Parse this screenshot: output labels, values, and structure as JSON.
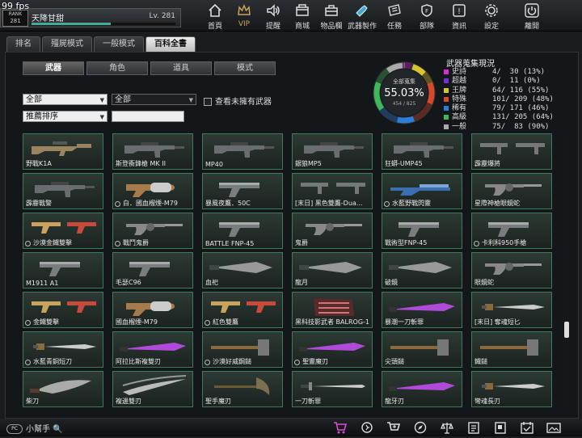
{
  "fps": "99 fps",
  "player": {
    "rank": "281",
    "name": "天降甘甜",
    "level": "Lv. 281",
    "xp_fraction": 0.55
  },
  "nav": [
    {
      "label": "首頁",
      "icon": "home-icon"
    },
    {
      "label": "VIP",
      "icon": "crown-icon"
    },
    {
      "label": "提醒",
      "icon": "speaker-icon"
    },
    {
      "label": "商城",
      "icon": "shop-icon"
    },
    {
      "label": "物品欄",
      "icon": "bag-icon"
    },
    {
      "label": "武器製作",
      "icon": "craft-icon"
    },
    {
      "label": "任務",
      "icon": "ticket-icon"
    },
    {
      "label": "部隊",
      "icon": "shield-icon"
    },
    {
      "label": "資訊",
      "icon": "info-icon"
    },
    {
      "label": "設定",
      "icon": "gear-icon"
    },
    {
      "label": "離開",
      "icon": "power-icon"
    }
  ],
  "tabs": [
    "排名",
    "殭屍模式",
    "一般模式",
    "百科全書"
  ],
  "subtabs": [
    "武器",
    "角色",
    "道具",
    "模式"
  ],
  "filters": {
    "category": "全部",
    "subcategory": "全部",
    "sort": "推薦排序",
    "search": ""
  },
  "show_unowned_label": "查看未擁有武器",
  "collection": {
    "title": "武器蒐集現況",
    "donut_label": "全部蒐集",
    "percent": "55.03%",
    "counts": "454 / 825",
    "rows": [
      {
        "name": "史詩",
        "count": "4/  30",
        "pct": "(13%)",
        "color": "#d82bd8",
        "frac": 0.13
      },
      {
        "name": "超越",
        "count": "0/  11",
        "pct": "(0%)",
        "color": "#7b2bd8",
        "frac": 0.0
      },
      {
        "name": "王牌",
        "count": "64/ 116",
        "pct": "(55%)",
        "color": "#d8c42b",
        "frac": 0.55
      },
      {
        "name": "特殊",
        "count": "101/ 209",
        "pct": "(48%)",
        "color": "#d8492b",
        "frac": 0.48
      },
      {
        "name": "稀有",
        "count": "79/ 171",
        "pct": "(46%)",
        "color": "#2b7fd8",
        "frac": 0.46
      },
      {
        "name": "高級",
        "count": "131/ 205",
        "pct": "(64%)",
        "color": "#3fb85a",
        "frac": 0.64
      },
      {
        "name": "一般",
        "count": "75/  83",
        "pct": "(90%)",
        "color": "#aaaaaa",
        "frac": 0.9
      }
    ]
  },
  "weapons": [
    {
      "name": "野戰K1A",
      "icon": "rifle-icon",
      "marked": false
    },
    {
      "name": "斯登衝鋒槍 MK II",
      "icon": "smg-icon",
      "marked": false
    },
    {
      "name": "MP40",
      "icon": "smg-icon",
      "marked": false
    },
    {
      "name": "銀狼MP5",
      "icon": "smg-icon",
      "marked": false
    },
    {
      "name": "狂蟒-UMP45",
      "icon": "smg-icon",
      "marked": false
    },
    {
      "name": "霹靂爆將",
      "icon": "dual-smg-icon",
      "marked": false
    },
    {
      "name": "霹靂戰警",
      "icon": "smg-icon",
      "marked": false
    },
    {
      "name": "白．國血榴煙-M79",
      "icon": "grenade-launcher-icon",
      "marked": true
    },
    {
      "name": "暴風夜鷹．50C",
      "icon": "pistol-icon",
      "marked": false
    },
    {
      "name": "[末日] 黑色雙鷹-Dua...",
      "icon": "dual-smg-icon",
      "marked": false
    },
    {
      "name": "水藍野戰閃靈",
      "icon": "shotgun-icon",
      "marked": true
    },
    {
      "name": "星際神槍眼鏡蛇",
      "icon": "revolver-icon",
      "marked": false
    },
    {
      "name": "沙漠金鐵雙擊",
      "icon": "dual-pistol-icon",
      "marked": true
    },
    {
      "name": "戰鬥鬼爵",
      "icon": "revolver-icon",
      "marked": true
    },
    {
      "name": "BATTLE FNP-45",
      "icon": "pistol-icon",
      "marked": false
    },
    {
      "name": "鬼爵",
      "icon": "revolver-icon",
      "marked": false
    },
    {
      "name": "戰術型FNP-45",
      "icon": "pistol-icon",
      "marked": false
    },
    {
      "name": "卡利科950手槍",
      "icon": "pistol-icon",
      "marked": true
    },
    {
      "name": "M1911 A1",
      "icon": "pistol-icon",
      "marked": false
    },
    {
      "name": "毛瑟C96",
      "icon": "pistol-icon",
      "marked": false
    },
    {
      "name": "血祀",
      "icon": "knife-icon",
      "marked": false
    },
    {
      "name": "龍月",
      "icon": "knife-icon",
      "marked": false
    },
    {
      "name": "破鏡",
      "icon": "knife-icon",
      "marked": false
    },
    {
      "name": "眼鏡蛇",
      "icon": "revolver-icon",
      "marked": false
    },
    {
      "name": "金鐵雙擊",
      "icon": "dual-pistol-icon",
      "marked": true
    },
    {
      "name": "國血榴煙-M79",
      "icon": "grenade-launcher-icon",
      "marked": false
    },
    {
      "name": "紅色雙鷹",
      "icon": "dual-pistol-icon",
      "marked": true
    },
    {
      "name": "黑科技影武者 BALROG-1",
      "icon": "knuckle-icon",
      "marked": false
    },
    {
      "name": "暴潮一刀斬罪",
      "icon": "blade-icon",
      "marked": false
    },
    {
      "name": "[末日] 奪魂短匕",
      "icon": "dagger-icon",
      "marked": false
    },
    {
      "name": "水藍青銅短刀",
      "icon": "dagger-icon",
      "marked": true
    },
    {
      "name": "阿拉比斯複雙刃",
      "icon": "blade-icon",
      "marked": false
    },
    {
      "name": "沙漠好威鋼鎚",
      "icon": "hammer-icon",
      "marked": true
    },
    {
      "name": "聖靈魔刃",
      "icon": "blade-icon",
      "marked": true
    },
    {
      "name": "尖頭鎚",
      "icon": "hammer-icon",
      "marked": false
    },
    {
      "name": "鐵鎚",
      "icon": "hammer-icon",
      "marked": false
    },
    {
      "name": "柴刀",
      "icon": "machete-icon",
      "marked": false
    },
    {
      "name": "複邊雙刃",
      "icon": "scimitar-icon",
      "marked": false
    },
    {
      "name": "聖手魔刃",
      "icon": "axe-icon",
      "marked": false
    },
    {
      "name": "一刀斬罪",
      "icon": "sword-icon",
      "marked": false
    },
    {
      "name": "龍牙刃",
      "icon": "blade-icon",
      "marked": false
    },
    {
      "name": "彎魂長刃",
      "icon": "dagger-icon",
      "marked": false
    }
  ],
  "scroll_position": 0.72,
  "helper": {
    "pill": "PC",
    "label": "小幫手"
  },
  "bottom_icons": [
    "cart-icon",
    "walk-icon",
    "cart-plus-icon",
    "compass-icon",
    "balance-icon",
    "list-icon",
    "card-icon",
    "calendar-check-icon",
    "gallery-icon"
  ]
}
